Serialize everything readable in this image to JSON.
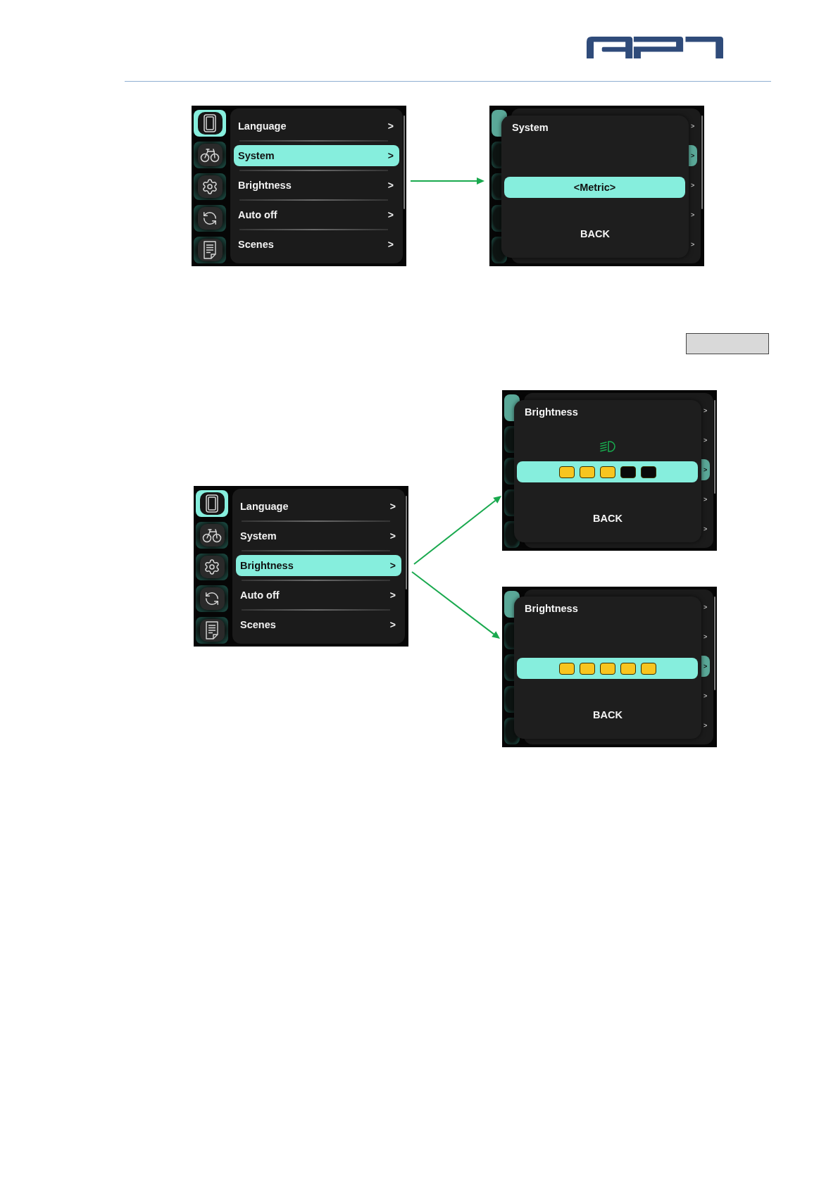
{
  "flows": [
    {
      "source": {
        "kind": "menu",
        "tabs": [
          {
            "selected": true
          },
          {
            "selected": false
          },
          {
            "selected": false
          },
          {
            "selected": false
          },
          {
            "selected": false
          }
        ],
        "items": [
          {
            "label": "Language",
            "arrow": ">",
            "selected": false
          },
          {
            "label": "System",
            "arrow": ">",
            "selected": true
          },
          {
            "label": "Brightness",
            "arrow": ">",
            "selected": false
          },
          {
            "label": "Auto off",
            "arrow": ">",
            "selected": false
          },
          {
            "label": "Scenes",
            "arrow": ">",
            "selected": false
          }
        ]
      },
      "targets": [
        {
          "kind": "dialog",
          "tabs": [
            {
              "selected": true
            },
            {
              "selected": false
            },
            {
              "selected": false
            },
            {
              "selected": false
            },
            {
              "selected": false
            }
          ],
          "items": [
            {
              "arrow": ">",
              "selected": false
            },
            {
              "arrow": ">",
              "selected": true
            },
            {
              "arrow": ">",
              "selected": false
            },
            {
              "arrow": ">",
              "selected": false
            },
            {
              "arrow": ">",
              "selected": false
            }
          ],
          "dialog": {
            "title": "System",
            "control": {
              "kind": "option",
              "value": "<Metric>"
            },
            "back": "BACK"
          }
        }
      ]
    },
    {
      "source": {
        "kind": "menu",
        "tabs": [
          {
            "selected": true
          },
          {
            "selected": false
          },
          {
            "selected": false
          },
          {
            "selected": false
          },
          {
            "selected": false
          }
        ],
        "items": [
          {
            "label": "Language",
            "arrow": ">",
            "selected": false
          },
          {
            "label": "System",
            "arrow": ">",
            "selected": false
          },
          {
            "label": "Brightness",
            "arrow": ">",
            "selected": true
          },
          {
            "label": "Auto off",
            "arrow": ">",
            "selected": false
          },
          {
            "label": "Scenes",
            "arrow": ">",
            "selected": false
          }
        ]
      },
      "targets": [
        {
          "kind": "dialog",
          "tabs": [
            {
              "selected": true
            },
            {
              "selected": false
            },
            {
              "selected": false
            },
            {
              "selected": false
            },
            {
              "selected": false
            }
          ],
          "items": [
            {
              "arrow": ">",
              "selected": false
            },
            {
              "arrow": ">",
              "selected": false
            },
            {
              "arrow": ">",
              "selected": true
            },
            {
              "arrow": ">",
              "selected": false
            },
            {
              "arrow": ">",
              "selected": false
            }
          ],
          "dialog": {
            "title": "Brightness",
            "control": {
              "kind": "segments",
              "stars": 3,
              "light_on": true
            },
            "back": "BACK"
          }
        },
        {
          "kind": "dialog",
          "tabs": [
            {
              "selected": true
            },
            {
              "selected": false
            },
            {
              "selected": false
            },
            {
              "selected": false
            },
            {
              "selected": false
            }
          ],
          "items": [
            {
              "arrow": ">",
              "selected": false
            },
            {
              "arrow": ">",
              "selected": false
            },
            {
              "arrow": ">",
              "selected": true
            },
            {
              "arrow": ">",
              "selected": false
            },
            {
              "arrow": ">",
              "selected": false
            }
          ],
          "dialog": {
            "title": "Brightness",
            "control": {
              "kind": "segments",
              "stars": 5,
              "light_on": false
            },
            "back": "BACK"
          }
        }
      ]
    }
  ]
}
